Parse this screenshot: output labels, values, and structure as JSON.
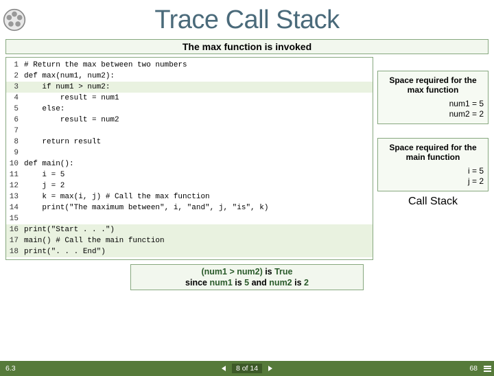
{
  "title": "Trace Call Stack",
  "subtitle": "The max function is invoked",
  "code": {
    "lines": [
      {
        "n": "1",
        "t": "# Return the max between two numbers",
        "hl": false
      },
      {
        "n": "2",
        "t": "def max(num1, num2):",
        "hl": false
      },
      {
        "n": "3",
        "t": "    if num1 > num2:",
        "hl": true
      },
      {
        "n": "4",
        "t": "        result = num1",
        "hl": false
      },
      {
        "n": "5",
        "t": "    else:",
        "hl": false
      },
      {
        "n": "6",
        "t": "        result = num2",
        "hl": false
      },
      {
        "n": "7",
        "t": "",
        "hl": false
      },
      {
        "n": "8",
        "t": "    return result",
        "hl": false
      },
      {
        "n": "9",
        "t": "",
        "hl": false
      },
      {
        "n": "10",
        "t": "def main():",
        "hl": false
      },
      {
        "n": "11",
        "t": "    i = 5",
        "hl": false
      },
      {
        "n": "12",
        "t": "    j = 2",
        "hl": false
      },
      {
        "n": "13",
        "t": "    k = max(i, j) # Call the max function",
        "hl": false
      },
      {
        "n": "14",
        "t": "    print(\"The maximum between\", i, \"and\", j, \"is\", k)",
        "hl": false
      },
      {
        "n": "15",
        "t": "",
        "hl": false
      },
      {
        "n": "16",
        "t": "print(\"Start . . .\")",
        "hl": true
      },
      {
        "n": "17",
        "t": "main() # Call the main function",
        "hl": true
      },
      {
        "n": "18",
        "t": "print(\". . . End\")",
        "hl": true
      }
    ]
  },
  "stack": {
    "frames": [
      {
        "hdr": "Space required for the max function",
        "vars": [
          "num1 = 5",
          "num2 = 2"
        ]
      },
      {
        "hdr": "Space required for the main function",
        "vars": [
          "i = 5",
          "j = 2"
        ]
      }
    ],
    "label": "Call Stack"
  },
  "explain": {
    "line1_a": "(num1 > num2)",
    "line1_b": " is ",
    "line1_c": "True",
    "line2_a": "since ",
    "line2_b": "num1",
    "line2_c": " is ",
    "line2_d": "5",
    "line2_e": " and ",
    "line2_f": "num2",
    "line2_g": " is ",
    "line2_h": "2"
  },
  "footer": {
    "section": "6.3",
    "page_of": "8 of 14",
    "page_num": "68"
  }
}
